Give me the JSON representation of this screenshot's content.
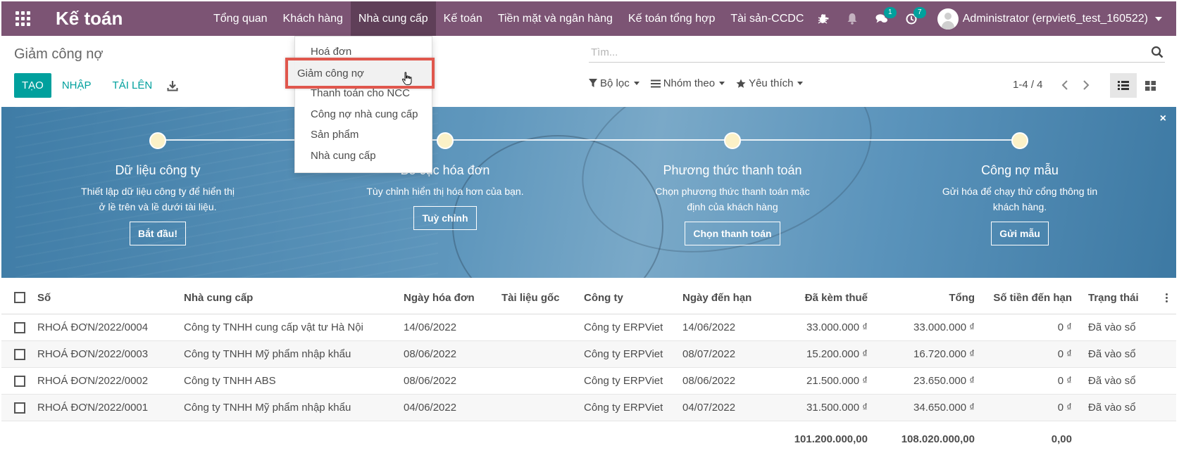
{
  "navbar": {
    "brand": "Kế toán",
    "menu": [
      {
        "label": "Tổng quan"
      },
      {
        "label": "Khách hàng"
      },
      {
        "label": "Nhà cung cấp"
      },
      {
        "label": "Kế toán"
      },
      {
        "label": "Tiền mặt và ngân hàng"
      },
      {
        "label": "Kế toán tổng hợp"
      },
      {
        "label": "Tài sản-CCDC"
      }
    ],
    "plus": "+",
    "messages_badge": "1",
    "activities_badge": "7",
    "user": "Administrator (erpviet6_test_160522)"
  },
  "dropdown": {
    "items": [
      "Hoá đơn",
      "Giảm công nợ",
      "Thanh toán cho NCC",
      "Công nợ nhà cung cấp",
      "Sản phẩm",
      "Nhà cung cấp"
    ],
    "highlighted": "Giảm công nợ"
  },
  "control": {
    "title": "Giảm công nợ",
    "create": "TẠO",
    "import": "NHẬP",
    "upload": "TẢI LÊN",
    "search_placeholder": "Tìm...",
    "filter": "Bộ lọc",
    "group_by": "Nhóm theo",
    "favorites": "Yêu thích",
    "pager": "1-4 / 4"
  },
  "banner": {
    "steps": [
      {
        "title": "Dữ liệu công ty",
        "desc1": "Thiết lập dữ liệu công ty để hiển thị",
        "desc2": "ở lề trên và lề dưới tài liệu.",
        "button": "Bắt đầu!"
      },
      {
        "title": "Bố cục hóa đơn",
        "desc1": "Tùy chỉnh hiển thị hóa hơn của bạn.",
        "desc2": "",
        "button": "Tuỳ chỉnh"
      },
      {
        "title": "Phương thức thanh toán",
        "desc1": "Chọn phương thức thanh toán mặc",
        "desc2": "định của khách hàng",
        "button": "Chọn thanh toán"
      },
      {
        "title": "Công nợ mẫu",
        "desc1": "Gửi hóa để chạy thử cổng thông tin",
        "desc2": "khách hàng.",
        "button": "Gửi mẫu"
      }
    ],
    "close": "×"
  },
  "table": {
    "headers": {
      "number": "Số",
      "vendor": "Nhà cung cấp",
      "invoice_date": "Ngày hóa đơn",
      "source": "Tài liệu gốc",
      "company": "Công ty",
      "due_date": "Ngày đến hạn",
      "tax_included": "Đã kèm thuế",
      "total": "Tổng",
      "amount_due": "Số tiền đến hạn",
      "status": "Trạng thái"
    },
    "rows": [
      {
        "number": "RHOÁ ĐƠN/2022/0004",
        "vendor": "Công ty TNHH cung cấp vật tư Hà Nội",
        "invoice_date": "14/06/2022",
        "source": "",
        "company": "Công ty ERPViet",
        "due_date": "14/06/2022",
        "tax_included": "33.000.000 ₫",
        "total": "33.000.000 ₫",
        "amount_due": "0 ₫",
        "status": "Đã vào sổ"
      },
      {
        "number": "RHOÁ ĐƠN/2022/0003",
        "vendor": "Công ty TNHH Mỹ phẩm nhập khẩu",
        "invoice_date": "08/06/2022",
        "source": "",
        "company": "Công ty ERPViet",
        "due_date": "08/07/2022",
        "tax_included": "15.200.000 ₫",
        "total": "16.720.000 ₫",
        "amount_due": "0 ₫",
        "status": "Đã vào sổ"
      },
      {
        "number": "RHOÁ ĐƠN/2022/0002",
        "vendor": "Công ty TNHH ABS",
        "invoice_date": "08/06/2022",
        "source": "",
        "company": "Công ty ERPViet",
        "due_date": "08/06/2022",
        "tax_included": "21.500.000 ₫",
        "total": "23.650.000 ₫",
        "amount_due": "0 ₫",
        "status": "Đã vào sổ"
      },
      {
        "number": "RHOÁ ĐƠN/2022/0001",
        "vendor": "Công ty TNHH Mỹ phẩm nhập khẩu",
        "invoice_date": "04/06/2022",
        "source": "",
        "company": "Công ty ERPViet",
        "due_date": "04/07/2022",
        "tax_included": "31.500.000 ₫",
        "total": "34.650.000 ₫",
        "amount_due": "0 ₫",
        "status": "Đã vào sổ"
      }
    ],
    "totals": {
      "tax_included": "101.200.000,00",
      "total": "108.020.000,00",
      "amount_due": "0,00"
    }
  },
  "colors": {
    "navbar": "#7c5474",
    "accent": "#00a09d",
    "highlight_border": "#e0574d"
  }
}
